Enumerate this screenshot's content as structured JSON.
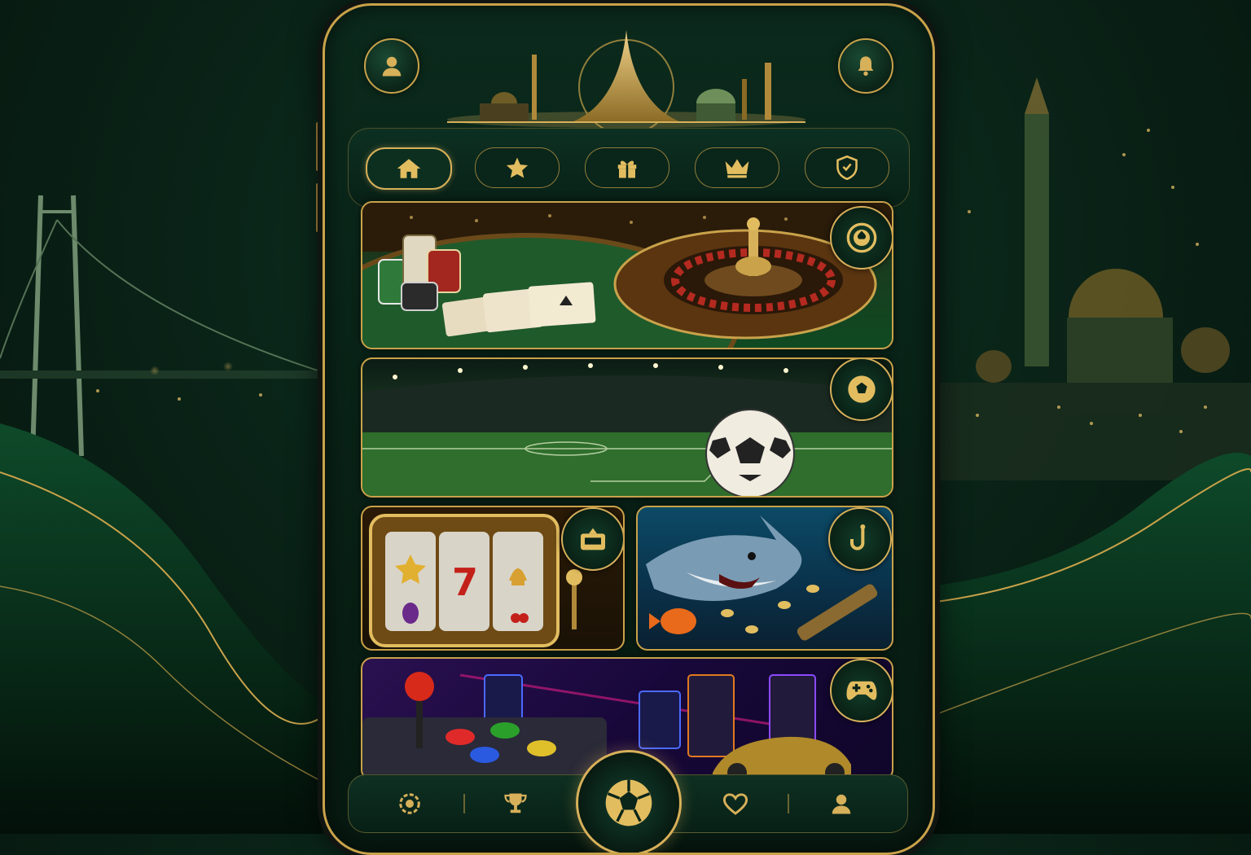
{
  "app": {
    "accent_color": "#c9a24a",
    "background_color": "#0a2418"
  },
  "header": {
    "profile_icon": "user-icon",
    "notification_icon": "bell-icon"
  },
  "tabs": [
    {
      "icon": "home-icon",
      "active": true
    },
    {
      "icon": "star-icon",
      "active": false
    },
    {
      "icon": "gift-icon",
      "active": false
    },
    {
      "icon": "crown-icon",
      "active": false
    },
    {
      "icon": "shield-icon",
      "active": false
    }
  ],
  "cards": [
    {
      "name": "casino",
      "badge_icon": "poker-chip-icon"
    },
    {
      "name": "sports",
      "badge_icon": "soccer-ball-icon"
    },
    {
      "name": "slots",
      "badge_icon": "slot-machine-icon"
    },
    {
      "name": "fishing",
      "badge_icon": "fishing-hook-icon"
    },
    {
      "name": "arcade",
      "badge_icon": "gamepad-icon"
    }
  ],
  "bottom_nav": [
    {
      "icon": "chip-icon"
    },
    {
      "icon": "trophy-icon"
    },
    {
      "icon": "soccer-ball-icon",
      "center": true
    },
    {
      "icon": "heart-icon"
    },
    {
      "icon": "user-icon"
    }
  ]
}
